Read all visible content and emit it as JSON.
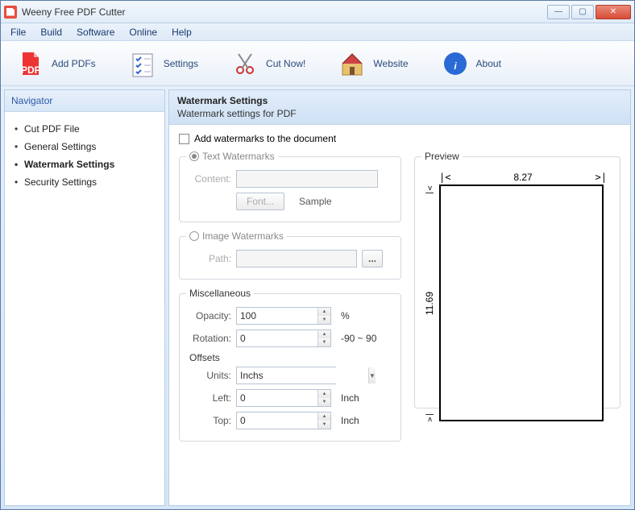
{
  "window": {
    "title": "Weeny Free PDF Cutter"
  },
  "menubar": [
    "File",
    "Build",
    "Software",
    "Online",
    "Help"
  ],
  "toolbar": [
    {
      "label": "Add PDFs"
    },
    {
      "label": "Settings"
    },
    {
      "label": "Cut Now!"
    },
    {
      "label": "Website"
    },
    {
      "label": "About"
    }
  ],
  "navigator": {
    "title": "Navigator",
    "items": [
      "Cut PDF File",
      "General Settings",
      "Watermark Settings",
      "Security Settings"
    ],
    "selected_index": 2
  },
  "main": {
    "title": "Watermark Settings",
    "subtitle": "Watermark settings for PDF",
    "add_watermarks_label": "Add watermarks to the document",
    "add_watermarks_checked": false,
    "text_wm": {
      "legend": "Text Watermarks",
      "content_label": "Content:",
      "content_value": "",
      "font_button": "Font...",
      "sample_label": "Sample"
    },
    "image_wm": {
      "legend": "Image Watermarks",
      "path_label": "Path:",
      "path_value": "",
      "browse": "..."
    },
    "misc": {
      "legend": "Miscellaneous",
      "opacity_label": "Opacity:",
      "opacity_value": "100",
      "opacity_unit": "%",
      "rotation_label": "Rotation:",
      "rotation_value": "0",
      "rotation_hint": "-90 ~ 90",
      "offsets_label": "Offsets",
      "units_label": "Units:",
      "units_value": "Inchs",
      "left_label": "Left:",
      "left_value": "0",
      "left_unit": "Inch",
      "top_label": "Top:",
      "top_value": "0",
      "top_unit": "Inch"
    },
    "preview": {
      "legend": "Preview",
      "width": "8.27",
      "height": "11.69"
    }
  }
}
